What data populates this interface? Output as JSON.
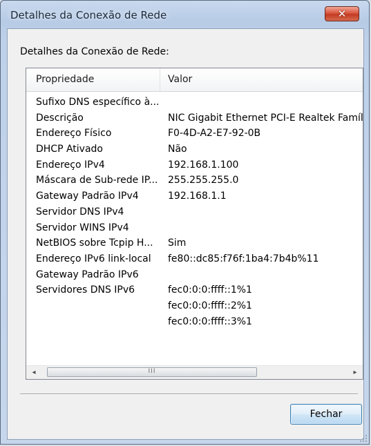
{
  "window": {
    "title": "Detalhes da Conexão de Rede",
    "close_icon": "close-icon"
  },
  "group_label": "Detalhes da Conexão de Rede:",
  "listview": {
    "columns": [
      "Propriedade",
      "Valor"
    ],
    "rows": [
      {
        "property": "Sufixo DNS específico à...",
        "value": ""
      },
      {
        "property": "Descrição",
        "value": "NIC Gigabit Ethernet PCI-E Realtek Famíl"
      },
      {
        "property": "Endereço Físico",
        "value": "F0-4D-A2-E7-92-0B"
      },
      {
        "property": "DHCP Ativado",
        "value": "Não"
      },
      {
        "property": "Endereço IPv4",
        "value": "192.168.1.100"
      },
      {
        "property": "Máscara de Sub-rede IP...",
        "value": "255.255.255.0"
      },
      {
        "property": "Gateway Padrão IPv4",
        "value": "192.168.1.1"
      },
      {
        "property": "Servidor DNS IPv4",
        "value": ""
      },
      {
        "property": "Servidor WINS IPv4",
        "value": ""
      },
      {
        "property": "NetBIOS sobre Tcpip H...",
        "value": "Sim"
      },
      {
        "property": "Endereço IPv6 link-local",
        "value": "fe80::dc85:f76f:1ba4:7b4b%11"
      },
      {
        "property": "Gateway Padrão IPv6",
        "value": ""
      },
      {
        "property": "Servidores DNS IPv6",
        "value": "fec0:0:0:ffff::1%1"
      },
      {
        "property": "",
        "value": "fec0:0:0:ffff::2%1"
      },
      {
        "property": "",
        "value": "fec0:0:0:ffff::3%1"
      }
    ],
    "scrollbar": {
      "thumb_grip": "III",
      "left_arrow": "◂",
      "right_arrow": "▸"
    }
  },
  "buttons": {
    "close_label": "Fechar"
  }
}
